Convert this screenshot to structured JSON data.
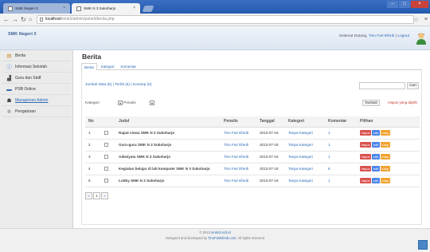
{
  "browser": {
    "tabs": [
      {
        "title": "SMK Negeri 3"
      },
      {
        "title": "SMK N 3 Sukoharjo"
      }
    ],
    "url_host": "localhost",
    "url_path": "/smk3/admin/pane/l/berita.php"
  },
  "header": {
    "brand": "SMK Negeri 3",
    "welcome_prefix": "Selamat Datang, ",
    "user_name": "Tino Fari Eferdi",
    "logout_label": "Logout"
  },
  "sidebar": {
    "items": [
      {
        "label": "Berita",
        "icon": "news-icon"
      },
      {
        "label": "Informasi Sekolah",
        "icon": "info-icon"
      },
      {
        "label": "Guru dan Staff",
        "icon": "staff-icon"
      },
      {
        "label": "PSB Online",
        "icon": "psb-icon"
      },
      {
        "label": "Manajemen Admin",
        "icon": "admin-icon"
      },
      {
        "label": "Pengaturan",
        "icon": "settings-icon"
      }
    ]
  },
  "main": {
    "title": "Berita",
    "tabs": [
      {
        "label": "Berita"
      },
      {
        "label": "Kategori"
      },
      {
        "label": "Komentar"
      }
    ],
    "counts": "Jumlah data (5) | Terbit (5) | Konsep (0)",
    "search_button": "Cari",
    "filter_kategori": "Kategori",
    "filter_penulis": "Penulis",
    "tambah_label": "Tambah",
    "hapus_selected_label": "Hapus yang dipilih"
  },
  "table": {
    "headers": [
      "No",
      "",
      "Judul",
      "Penulis",
      "Tanggal",
      "Kategori",
      "Komentar",
      "Pilihan"
    ],
    "rows": [
      {
        "no": "1",
        "judul": "Rapat siswa SMK N 3 Sukoharjo",
        "penulis": "Tino Fari Eferdi",
        "tanggal": "2013-07-18",
        "kategori": "Tanpa Kategori",
        "komentar": "1"
      },
      {
        "no": "2",
        "judul": "Guru-guru SMK N 3 Sukoharjo",
        "penulis": "Tino Fari Eferdi",
        "tanggal": "2013-07-18",
        "kategori": "Tanpa Kategori",
        "komentar": "1"
      },
      {
        "no": "3",
        "judul": "Adiwiyata SMK N 3 Sukoharjo",
        "penulis": "Tino Fari Eferdi",
        "tanggal": "2013-07-18",
        "kategori": "Tanpa Kategori",
        "komentar": "1"
      },
      {
        "no": "4",
        "judul": "Kegiatan belajar di lab komputer SMK N 3 Sukoharjo",
        "penulis": "Tino Fari Eferdi",
        "tanggal": "2013-07-18",
        "kategori": "Tanpa Kategori",
        "komentar": "6"
      },
      {
        "no": "5",
        "judul": "Lobby SMK N 3 Sukoharjo",
        "penulis": "Tino Fari Eferdi",
        "tanggal": "2013-07-18",
        "kategori": "Tanpa Kategori",
        "komentar": "1"
      }
    ],
    "action_labels": {
      "hapus": "hapus",
      "edit": "edit",
      "tutup": "tutup"
    }
  },
  "pager": {
    "prev": "«",
    "current": "1",
    "next": "»"
  },
  "footer": {
    "line1_prefix": "© 2013 ",
    "line1_link": "smkn3.sch.id",
    "line2_prefix": "Designed and developed by ",
    "line2_link": "TinoFariEferdi.com",
    "line2_suffix": ". All rights reserved"
  },
  "colors": {
    "link": "#2a6ab8",
    "hapus": "#d9534f",
    "edit": "#4a86e8",
    "tutup": "#f0a230"
  }
}
